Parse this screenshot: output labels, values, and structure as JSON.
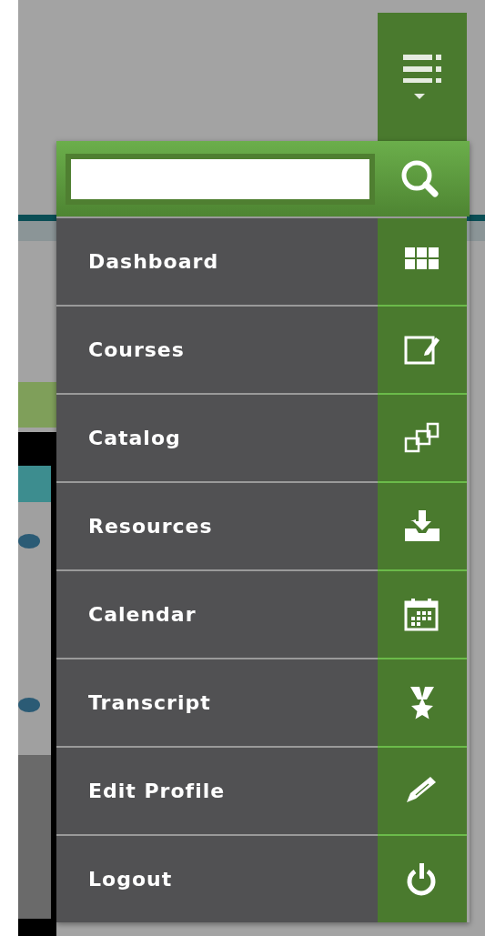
{
  "menu_button": {
    "expanded": true
  },
  "menu_items": [
    {
      "label": "Dashboard"
    },
    {
      "label": "Courses"
    },
    {
      "label": "Catalog"
    },
    {
      "label": "Resources"
    },
    {
      "label": "Calendar"
    },
    {
      "label": "Transcript"
    },
    {
      "label": "Edit Profile"
    },
    {
      "label": "Logout"
    }
  ]
}
